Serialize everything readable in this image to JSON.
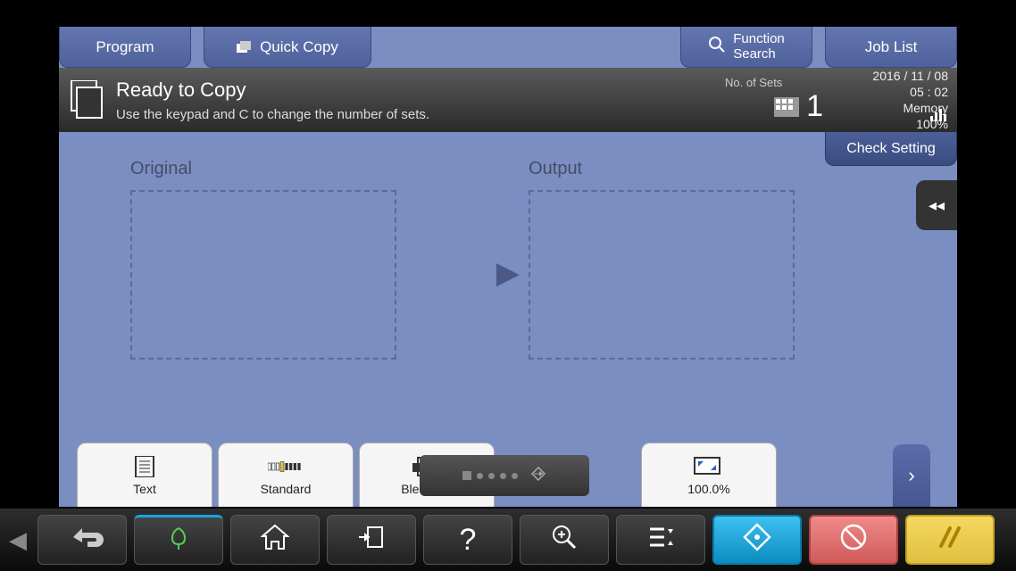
{
  "top": {
    "program": "Program",
    "quick_copy": "Quick Copy",
    "function_search": "Function\nSearch",
    "job_list": "Job List"
  },
  "status": {
    "title": "Ready to Copy",
    "subtitle": "Use the keypad and C to change the number of sets.",
    "sets_label": "No. of Sets",
    "sets_value": "1",
    "date": "2016 / 11 / 08",
    "time": "05 : 02",
    "memory_label": "Memory",
    "memory_value": "100%"
  },
  "check_setting": "Check Setting",
  "preview": {
    "original": "Original",
    "output": "Output"
  },
  "options": {
    "text": "Text",
    "standard": "Standard",
    "bleed": "Bleed Re",
    "zoom": "100.0%"
  }
}
